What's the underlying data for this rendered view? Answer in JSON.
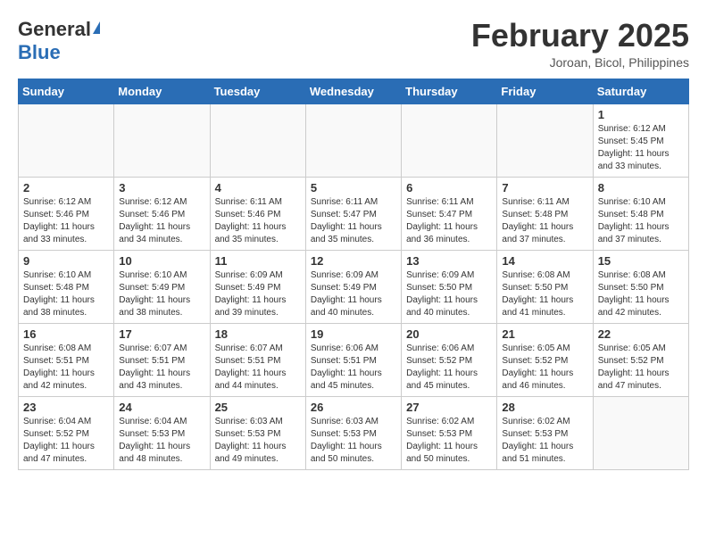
{
  "header": {
    "logo_general": "General",
    "logo_blue": "Blue",
    "month_year": "February 2025",
    "location": "Joroan, Bicol, Philippines"
  },
  "weekdays": [
    "Sunday",
    "Monday",
    "Tuesday",
    "Wednesday",
    "Thursday",
    "Friday",
    "Saturday"
  ],
  "weeks": [
    [
      {
        "day": "",
        "info": ""
      },
      {
        "day": "",
        "info": ""
      },
      {
        "day": "",
        "info": ""
      },
      {
        "day": "",
        "info": ""
      },
      {
        "day": "",
        "info": ""
      },
      {
        "day": "",
        "info": ""
      },
      {
        "day": "1",
        "info": "Sunrise: 6:12 AM\nSunset: 5:45 PM\nDaylight: 11 hours\nand 33 minutes."
      }
    ],
    [
      {
        "day": "2",
        "info": "Sunrise: 6:12 AM\nSunset: 5:46 PM\nDaylight: 11 hours\nand 33 minutes."
      },
      {
        "day": "3",
        "info": "Sunrise: 6:12 AM\nSunset: 5:46 PM\nDaylight: 11 hours\nand 34 minutes."
      },
      {
        "day": "4",
        "info": "Sunrise: 6:11 AM\nSunset: 5:46 PM\nDaylight: 11 hours\nand 35 minutes."
      },
      {
        "day": "5",
        "info": "Sunrise: 6:11 AM\nSunset: 5:47 PM\nDaylight: 11 hours\nand 35 minutes."
      },
      {
        "day": "6",
        "info": "Sunrise: 6:11 AM\nSunset: 5:47 PM\nDaylight: 11 hours\nand 36 minutes."
      },
      {
        "day": "7",
        "info": "Sunrise: 6:11 AM\nSunset: 5:48 PM\nDaylight: 11 hours\nand 37 minutes."
      },
      {
        "day": "8",
        "info": "Sunrise: 6:10 AM\nSunset: 5:48 PM\nDaylight: 11 hours\nand 37 minutes."
      }
    ],
    [
      {
        "day": "9",
        "info": "Sunrise: 6:10 AM\nSunset: 5:48 PM\nDaylight: 11 hours\nand 38 minutes."
      },
      {
        "day": "10",
        "info": "Sunrise: 6:10 AM\nSunset: 5:49 PM\nDaylight: 11 hours\nand 38 minutes."
      },
      {
        "day": "11",
        "info": "Sunrise: 6:09 AM\nSunset: 5:49 PM\nDaylight: 11 hours\nand 39 minutes."
      },
      {
        "day": "12",
        "info": "Sunrise: 6:09 AM\nSunset: 5:49 PM\nDaylight: 11 hours\nand 40 minutes."
      },
      {
        "day": "13",
        "info": "Sunrise: 6:09 AM\nSunset: 5:50 PM\nDaylight: 11 hours\nand 40 minutes."
      },
      {
        "day": "14",
        "info": "Sunrise: 6:08 AM\nSunset: 5:50 PM\nDaylight: 11 hours\nand 41 minutes."
      },
      {
        "day": "15",
        "info": "Sunrise: 6:08 AM\nSunset: 5:50 PM\nDaylight: 11 hours\nand 42 minutes."
      }
    ],
    [
      {
        "day": "16",
        "info": "Sunrise: 6:08 AM\nSunset: 5:51 PM\nDaylight: 11 hours\nand 42 minutes."
      },
      {
        "day": "17",
        "info": "Sunrise: 6:07 AM\nSunset: 5:51 PM\nDaylight: 11 hours\nand 43 minutes."
      },
      {
        "day": "18",
        "info": "Sunrise: 6:07 AM\nSunset: 5:51 PM\nDaylight: 11 hours\nand 44 minutes."
      },
      {
        "day": "19",
        "info": "Sunrise: 6:06 AM\nSunset: 5:51 PM\nDaylight: 11 hours\nand 45 minutes."
      },
      {
        "day": "20",
        "info": "Sunrise: 6:06 AM\nSunset: 5:52 PM\nDaylight: 11 hours\nand 45 minutes."
      },
      {
        "day": "21",
        "info": "Sunrise: 6:05 AM\nSunset: 5:52 PM\nDaylight: 11 hours\nand 46 minutes."
      },
      {
        "day": "22",
        "info": "Sunrise: 6:05 AM\nSunset: 5:52 PM\nDaylight: 11 hours\nand 47 minutes."
      }
    ],
    [
      {
        "day": "23",
        "info": "Sunrise: 6:04 AM\nSunset: 5:52 PM\nDaylight: 11 hours\nand 47 minutes."
      },
      {
        "day": "24",
        "info": "Sunrise: 6:04 AM\nSunset: 5:53 PM\nDaylight: 11 hours\nand 48 minutes."
      },
      {
        "day": "25",
        "info": "Sunrise: 6:03 AM\nSunset: 5:53 PM\nDaylight: 11 hours\nand 49 minutes."
      },
      {
        "day": "26",
        "info": "Sunrise: 6:03 AM\nSunset: 5:53 PM\nDaylight: 11 hours\nand 50 minutes."
      },
      {
        "day": "27",
        "info": "Sunrise: 6:02 AM\nSunset: 5:53 PM\nDaylight: 11 hours\nand 50 minutes."
      },
      {
        "day": "28",
        "info": "Sunrise: 6:02 AM\nSunset: 5:53 PM\nDaylight: 11 hours\nand 51 minutes."
      },
      {
        "day": "",
        "info": ""
      }
    ]
  ]
}
